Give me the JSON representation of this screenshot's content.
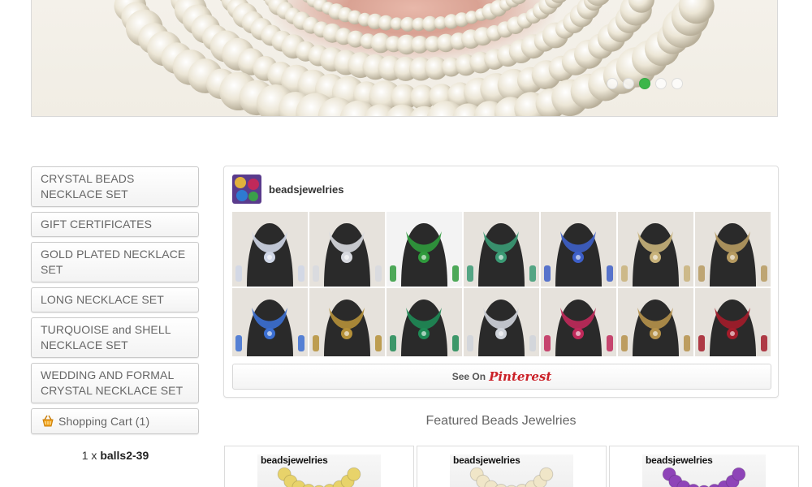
{
  "hero": {
    "slides": 5,
    "active_slide": 3
  },
  "sidebar": {
    "categories": [
      "CRYSTAL BEADS NECKLACE SET",
      "GIFT CERTIFICATES",
      "GOLD PLATED NECKLACE SET",
      "LONG NECKLACE SET",
      "TURQUOISE and SHELL NECKLACE SET",
      "WEDDING AND FORMAL CRYSTAL NECKLACE SET"
    ],
    "cart_label": "Shopping Cart (1)",
    "cart_qty": "1 x",
    "cart_item": "balls2-39"
  },
  "pinterest": {
    "username": "beadsjewelries",
    "see_on": "See On",
    "brand": "Pinterest",
    "thumb_colors": [
      "#cfd6e6",
      "#d7d9df",
      "#2f9a3c",
      "#3a9a74",
      "#3d5fc8",
      "#c8b27a",
      "#b69a60",
      "#3b6fd2",
      "#b59038",
      "#1e8a55",
      "#cfd3da",
      "#c0295a",
      "#b5914a",
      "#a31c2a"
    ]
  },
  "featured": {
    "title": "Featured Beads Jewelries",
    "products": [
      {
        "label": "beadsjewelries",
        "bead_color": "#e8d36a"
      },
      {
        "label": "beadsjewelries",
        "bead_color": "#f0e6c8"
      },
      {
        "label": "beadsjewelries",
        "bead_color": "#8e44b8"
      }
    ]
  }
}
